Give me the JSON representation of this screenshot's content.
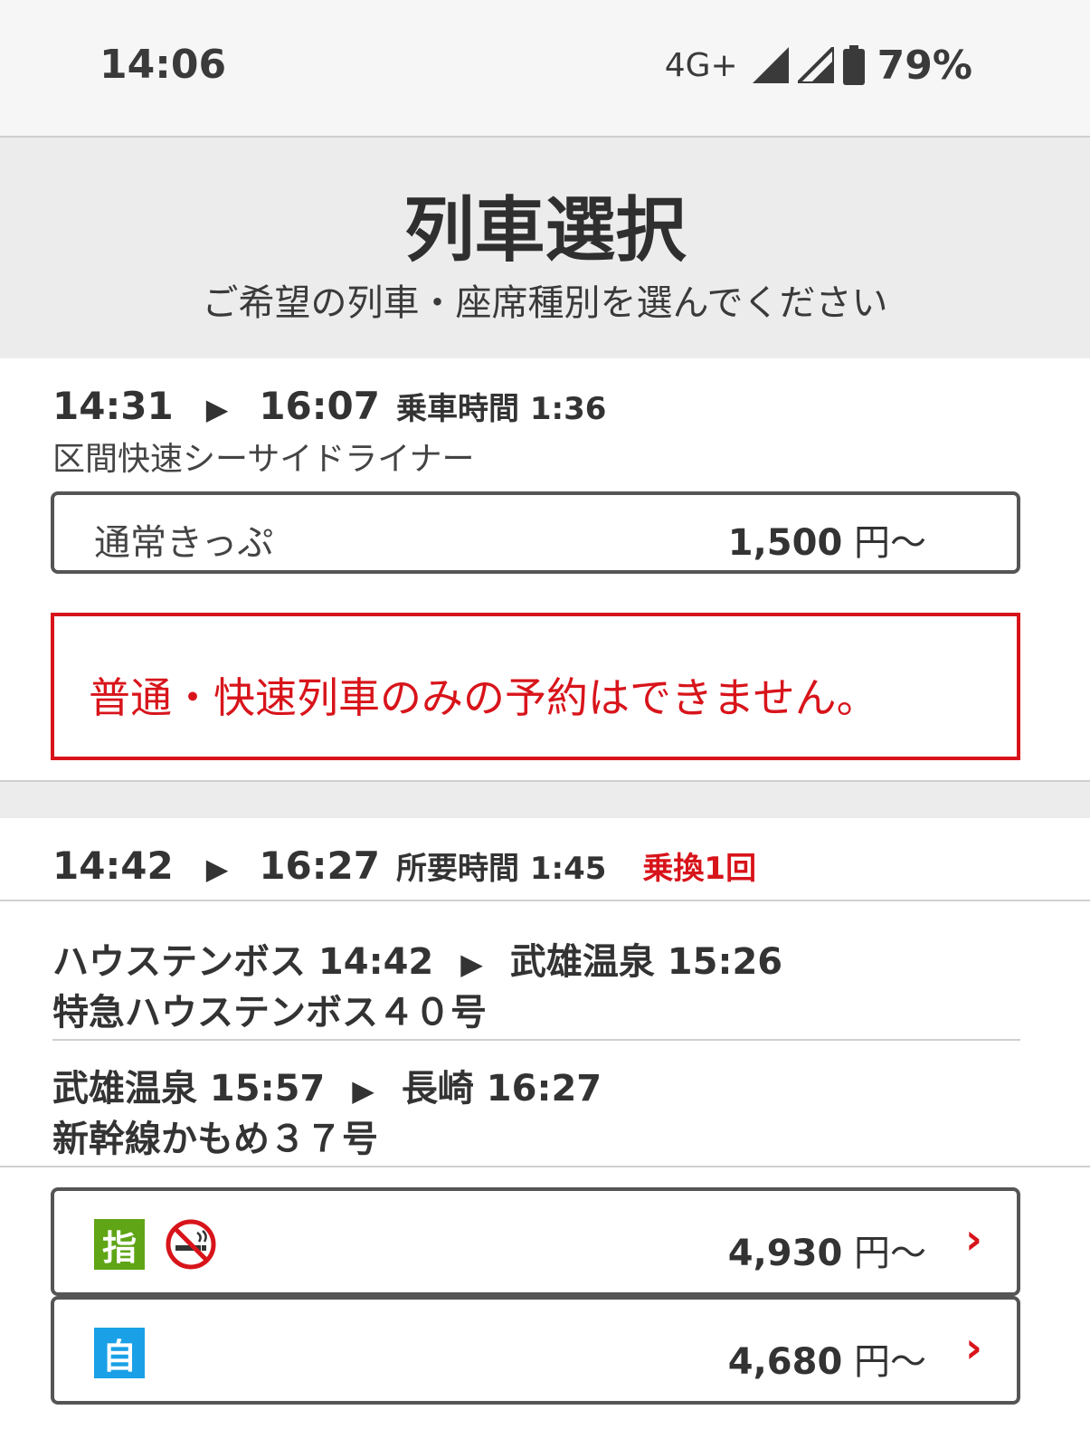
{
  "status_bar": {
    "time": "14:06",
    "network": "4G+",
    "battery": "79%"
  },
  "header": {
    "title": "列車選択",
    "subtitle": "ご希望の列車・座席種別を選んでください"
  },
  "option1": {
    "depart": "14:31",
    "arrow": "▶",
    "arrive": "16:07",
    "duration_label": "乗車時間 1:36",
    "train": "区間快速シーサイドライナー",
    "fare": {
      "label": "通常きっぷ",
      "price": "1,500",
      "unit": "円〜"
    },
    "warning": "普通・快速列車のみの予約はできません。"
  },
  "option2": {
    "depart": "14:42",
    "arrow": "▶",
    "arrive": "16:27",
    "duration_label": "所要時間 1:45",
    "transfer": "乗換1回",
    "legs": [
      {
        "from": "ハウステンボス 14:42",
        "to": "武雄温泉 15:26",
        "train": "特急ハウステンボス４０号"
      },
      {
        "from": "武雄温泉 15:57",
        "to": "長崎 16:27",
        "train": "新幹線かもめ３７号"
      }
    ],
    "fares": [
      {
        "badge": "指",
        "icon": "no-smoking-icon",
        "price": "4,930",
        "unit": "円〜",
        "chevron": "›"
      },
      {
        "badge": "自",
        "price": "4,680",
        "unit": "円〜",
        "chevron": "›"
      }
    ]
  },
  "colors": {
    "accent_red": "#d8141b",
    "reserved_green": "#5fa515",
    "free_blue": "#1aa0e6"
  }
}
